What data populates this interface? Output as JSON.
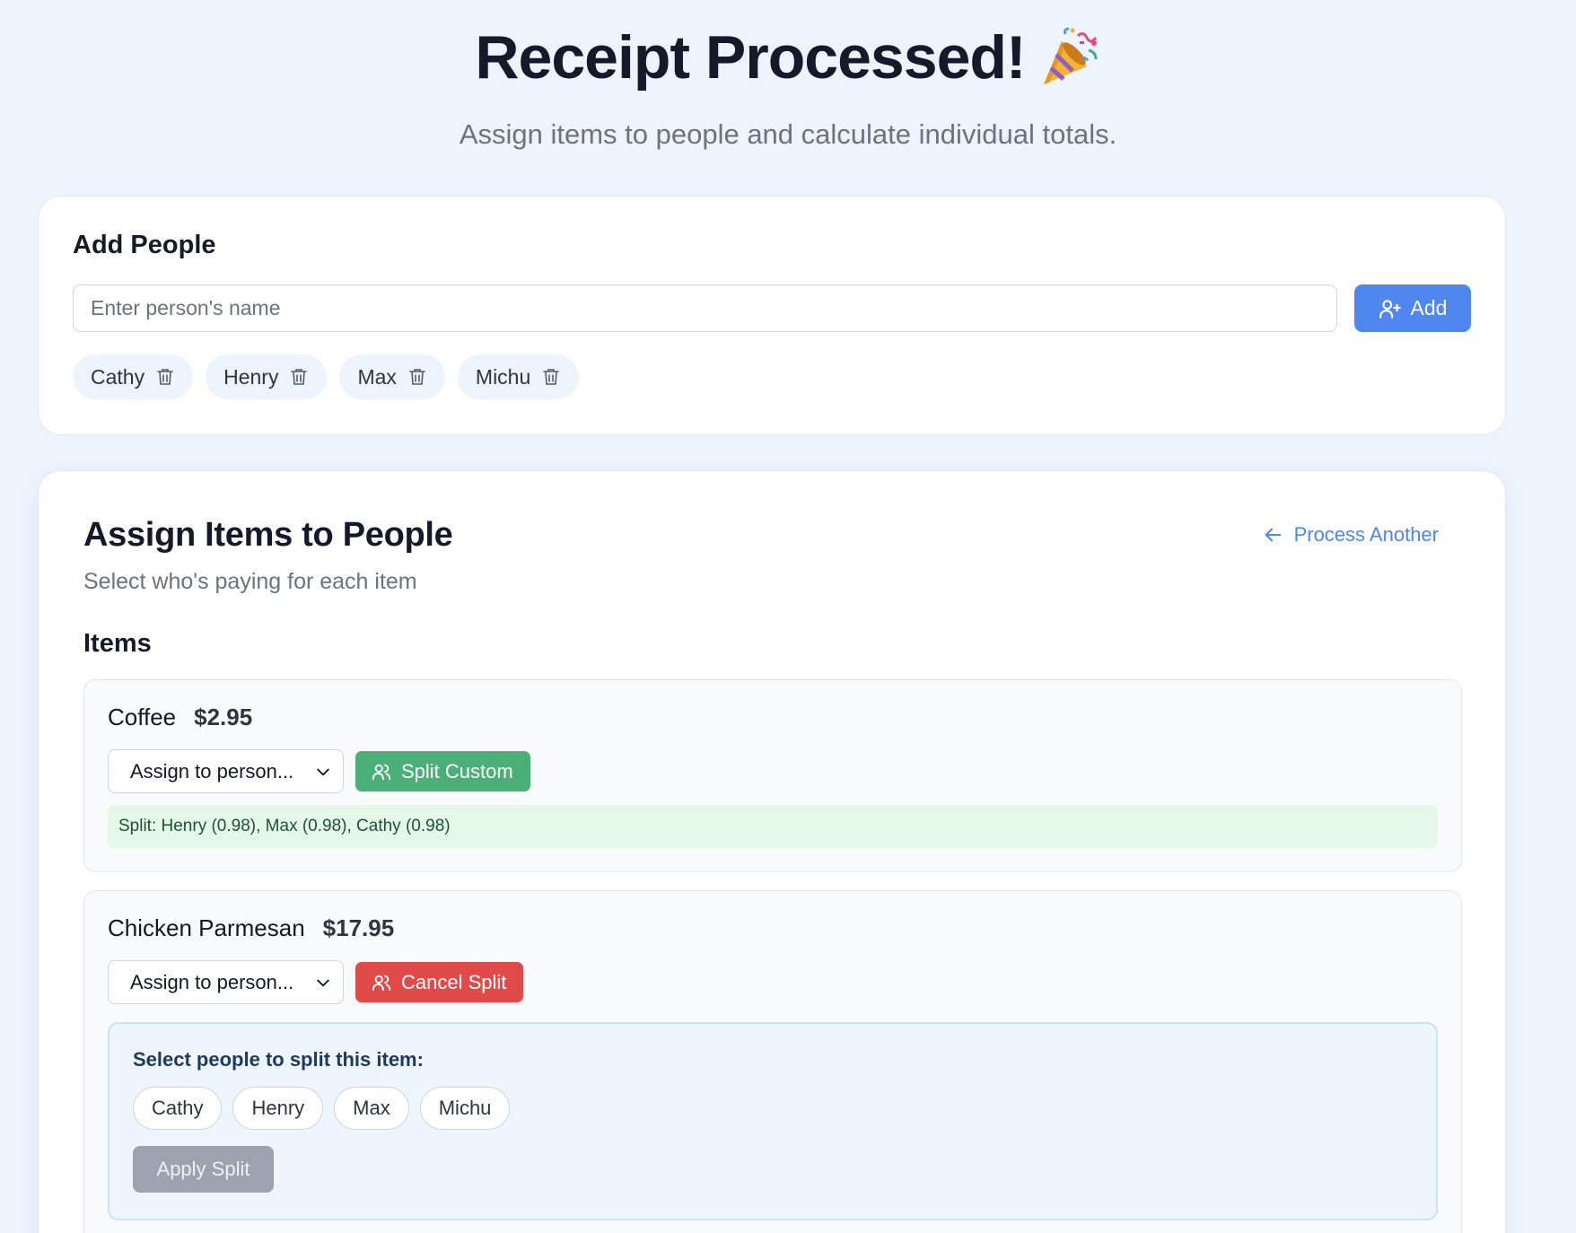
{
  "header": {
    "title": "Receipt Processed!",
    "subtitle": "Assign items to people and calculate individual totals."
  },
  "people_section": {
    "title": "Add People",
    "input_placeholder": "Enter person's name",
    "add_label": "Add",
    "people": [
      "Cathy",
      "Henry",
      "Max",
      "Michu"
    ]
  },
  "assign_section": {
    "title": "Assign Items to People",
    "subtitle": "Select who's paying for each item",
    "process_another_label": "Process Another",
    "items_title": "Items",
    "items": [
      {
        "name": "Coffee",
        "price": "$2.95",
        "select_value": "Assign to person...",
        "action_label": "Split Custom",
        "split_summary": "Split: Henry (0.98), Max (0.98), Cathy (0.98)"
      },
      {
        "name": "Chicken Parmesan",
        "price": "$17.95",
        "select_value": "Assign to person...",
        "action_label": "Cancel Split",
        "split_prompt": "Select people to split this item:",
        "split_options": [
          "Cathy",
          "Henry",
          "Max",
          "Michu"
        ],
        "apply_label": "Apply Split"
      }
    ]
  },
  "colors": {
    "background": "#eef4fe",
    "primary": "#4f86ef",
    "success": "#4bb077",
    "danger": "#e04b49",
    "disabled": "#9ca3af"
  }
}
